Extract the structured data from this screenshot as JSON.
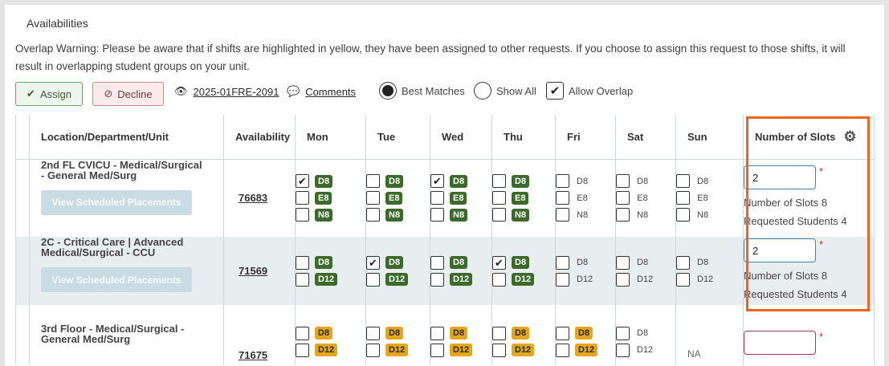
{
  "section_title": "Availabilities",
  "warning": "Overlap Warning: Please be aware that if shifts are highlighted in yellow, they have been assigned to other requests. If you choose to assign this request to those shifts, it will result in overlapping student groups on your unit.",
  "toolbar": {
    "assign_label": "Assign",
    "decline_label": "Decline",
    "request_id": "2025-01FRE-2091",
    "comments_label": "Comments",
    "best_matches_label": "Best Matches",
    "show_all_label": "Show All",
    "allow_overlap_label": "Allow Overlap"
  },
  "table": {
    "headers": {
      "location": "Location/Department/Unit",
      "availability": "Availability",
      "mon": "Mon",
      "tue": "Tue",
      "wed": "Wed",
      "thu": "Thu",
      "fri": "Fri",
      "sat": "Sat",
      "sun": "Sun",
      "slots": "Number of Slots"
    },
    "view_button_label": "View Scheduled Placements",
    "rows": [
      {
        "location": "2nd FL CVICU - Medical/Surgical - General Med/Surg",
        "availability": "76683",
        "slots_value": "2",
        "slots_info": "Number of Slots 8",
        "requested_info": "Requested Students 4"
      },
      {
        "location": "2C - Critical Care | Advanced Medical/Surgical - CCU",
        "availability": "71569",
        "slots_value": "2",
        "slots_info": "Number of Slots 8",
        "requested_info": "Requested Students 4"
      },
      {
        "location": "3rd Floor - Medical/Surgical - General Med/Surg",
        "availability": "71675",
        "slots_value": "",
        "sun_label": "NA"
      }
    ],
    "shift_labels": {
      "d8": "D8",
      "e8": "E8",
      "n8": "N8",
      "d12": "D12"
    }
  },
  "colors": {
    "highlight": "#f0641e",
    "badge_green": "#3c6a2a",
    "badge_orange": "#e4a61a"
  }
}
